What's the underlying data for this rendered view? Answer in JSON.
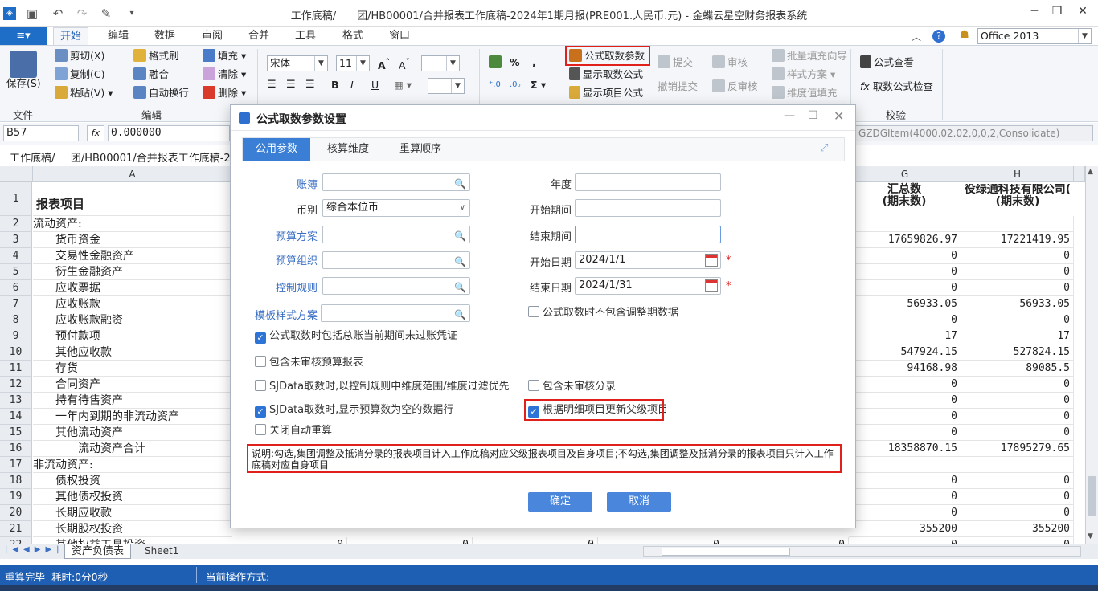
{
  "window": {
    "title": "工作底稿/    团/HB00001/合并报表工作底稿-2024年1期月报(PRE001.人民币.元) - 金蝶云星空财务报表系统"
  },
  "menu": {
    "app": "≡▾",
    "tabs": [
      "开始",
      "编辑",
      "数据",
      "审阅",
      "合并",
      "工具",
      "格式",
      "窗口"
    ],
    "office_theme": "Office 2013"
  },
  "ribbon": {
    "save": "保存(S)",
    "cut": "剪切(X)",
    "copy": "复制(C)",
    "paste": "粘贴(V)",
    "format_brush": "格式刷",
    "merge": "融合",
    "wrap": "自动换行",
    "fill": "填充",
    "clear": "清除",
    "delete": "删除",
    "font": "宋体",
    "size": "11",
    "percent": "%",
    "comma": ",",
    "sigma": "Σ",
    "fetch_params": "公式取数参数",
    "show_fetch_formula": "显示取数公式",
    "show_item_formula": "显示项目公式",
    "submit": "提交",
    "withdraw": "撤销提交",
    "review": "审核",
    "unreview": "反审核",
    "batch_fill": "批量填充向导",
    "style_scheme": "样式方案",
    "dim_fill": "维度值填充",
    "formula_view": "公式查看",
    "fetch_check": "取数公式检查",
    "group_file": "文件",
    "group_edit": "编辑",
    "group_check": "校验"
  },
  "formula_bar": {
    "cell": "B57",
    "value": "0.000000",
    "right_formula": "GZDGItem(4000.02.02,0,0,2,Consolidate)"
  },
  "breadcrumb": "工作底稿/   团/HB00001/合并报表工作底稿-20",
  "sheet": {
    "col_A": "A",
    "col_G": "G",
    "col_H": "H",
    "header_A": "报表项目",
    "header_G1": "汇总数",
    "header_G2": "(期末数)",
    "header_H1": "役绿通科技有限公司(",
    "header_H2": "(期末数)",
    "rows": [
      {
        "n": "1",
        "a": "",
        "g": "",
        "h": ""
      },
      {
        "n": "2",
        "a": "流动资产:",
        "g": "",
        "h": ""
      },
      {
        "n": "3",
        "a": "　　货币资金",
        "g": "17659826.97",
        "h": "17221419.95"
      },
      {
        "n": "4",
        "a": "　　交易性金融资产",
        "g": "0",
        "h": "0"
      },
      {
        "n": "5",
        "a": "　　衍生金融资产",
        "g": "0",
        "h": "0"
      },
      {
        "n": "6",
        "a": "　　应收票据",
        "g": "0",
        "h": "0"
      },
      {
        "n": "7",
        "a": "　　应收账款",
        "g": "56933.05",
        "h": "56933.05"
      },
      {
        "n": "8",
        "a": "　　应收账款融资",
        "g": "0",
        "h": "0"
      },
      {
        "n": "9",
        "a": "　　预付款项",
        "g": "17",
        "h": "17"
      },
      {
        "n": "10",
        "a": "　　其他应收款",
        "g": "547924.15",
        "h": "527824.15"
      },
      {
        "n": "11",
        "a": "　　存货",
        "g": "94168.98",
        "h": "89085.5"
      },
      {
        "n": "12",
        "a": "　　合同资产",
        "g": "0",
        "h": "0"
      },
      {
        "n": "13",
        "a": "　　持有待售资产",
        "g": "0",
        "h": "0"
      },
      {
        "n": "14",
        "a": "　　一年内到期的非流动资产",
        "g": "0",
        "h": "0"
      },
      {
        "n": "15",
        "a": "　　其他流动资产",
        "g": "0",
        "h": "0"
      },
      {
        "n": "16",
        "a": "　　　　流动资产合计",
        "g": "18358870.15",
        "h": "17895279.65"
      },
      {
        "n": "17",
        "a": "非流动资产:",
        "g": "",
        "h": ""
      },
      {
        "n": "18",
        "a": "　　债权投资",
        "g": "0",
        "h": "0"
      },
      {
        "n": "19",
        "a": "　　其他债权投资",
        "g": "0",
        "h": "0"
      },
      {
        "n": "20",
        "a": "　　长期应收款",
        "g": "0",
        "h": "0"
      },
      {
        "n": "21",
        "a": "　　长期股权投资",
        "g": "355200",
        "h": "355200"
      },
      {
        "n": "22",
        "a": "　　其他权益工具投资",
        "g": "0",
        "h": "0"
      }
    ],
    "row22_mid": [
      "0",
      "0",
      "0",
      "0",
      "0"
    ]
  },
  "sheet_tabs": [
    "资产负债表",
    "Sheet1"
  ],
  "status": {
    "left": "重算完毕  耗时:0分0秒",
    "right": "当前操作方式:"
  },
  "dialog": {
    "title": "公式取数参数设置",
    "tabs": [
      "公用参数",
      "核算维度",
      "重算顺序"
    ],
    "labels": {
      "book": "账簿",
      "currency": "币别",
      "budget_scheme": "预算方案",
      "budget_org": "预算组织",
      "control_rule": "控制规则",
      "template_style": "模板样式方案",
      "year": "年度",
      "start_period": "开始期间",
      "end_period": "结束期间",
      "start_date": "开始日期",
      "end_date": "结束日期"
    },
    "values": {
      "currency": "综合本位币",
      "start_date": "2024/1/1",
      "end_date": "2024/1/31"
    },
    "checks": {
      "exclude_adjust": "公式取数时不包含调整期数据",
      "include_unposted": "公式取数时包括总账当前期间未过账凭证",
      "include_unreviewed_budget": "包含未审核预算报表",
      "sjdata_filter": "SJData取数时,以控制规则中维度范围/维度过滤优先",
      "include_unreviewed_entry": "包含未审核分录",
      "sjdata_empty": "SJData取数时,显示预算数为空的数据行",
      "update_parent": "根据明细项目更新父级项目",
      "close_auto_recalc": "关闭自动重算"
    },
    "note": "说明:勾选,集团调整及抵消分录的报表项目计入工作底稿对应父级报表项目及自身项目;不勾选,集团调整及抵消分录的报表项目只计入工作底稿对应自身项目",
    "ok": "确定",
    "cancel": "取消"
  }
}
